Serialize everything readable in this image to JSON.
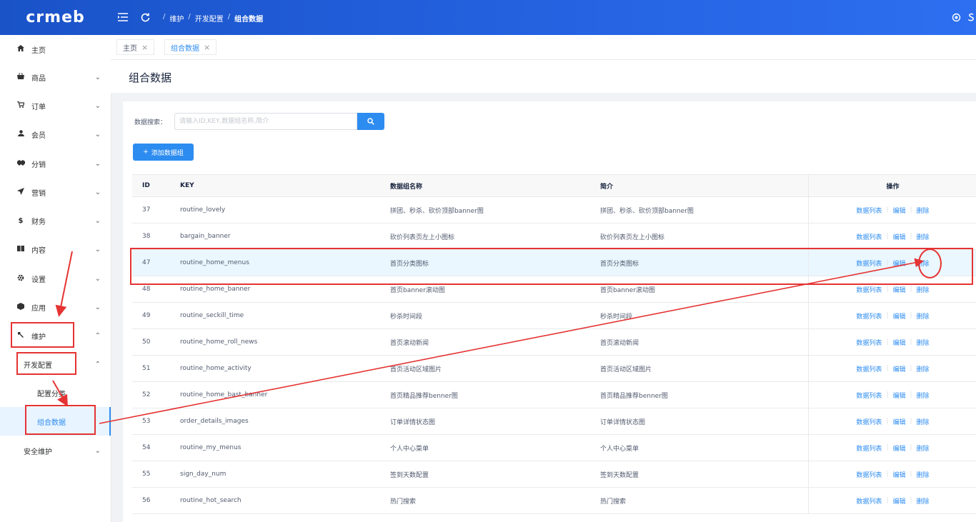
{
  "topbar": {
    "logo": "crmeb",
    "breadcrumb": [
      "维护",
      "开发配置",
      "组合数据"
    ],
    "colors": {
      "bar": "#1a53c8",
      "accent": "#2d8cf0"
    }
  },
  "sidebar": {
    "items": [
      {
        "label": "主页",
        "icon": "home-icon"
      },
      {
        "label": "商品",
        "icon": "shop-bag-icon"
      },
      {
        "label": "订单",
        "icon": "cart-icon"
      },
      {
        "label": "会员",
        "icon": "user-icon"
      },
      {
        "label": "分销",
        "icon": "handshake-icon"
      },
      {
        "label": "营销",
        "icon": "send-icon"
      },
      {
        "label": "财务",
        "icon": "dollar-icon"
      },
      {
        "label": "内容",
        "icon": "book-icon"
      },
      {
        "label": "设置",
        "icon": "gear-icon"
      },
      {
        "label": "应用",
        "icon": "cube-icon"
      },
      {
        "label": "维护",
        "icon": "hammer-icon"
      }
    ],
    "sub": {
      "dev_config": "开发配置",
      "config_category": "配置分类",
      "combined_data": "组合数据",
      "security": "安全维护"
    }
  },
  "tabs": [
    {
      "label": "主页"
    },
    {
      "label": "组合数据"
    }
  ],
  "page": {
    "title": "组合数据",
    "search_label": "数据搜索：",
    "search_placeholder": "请输入ID,KEY,数据组名称,简介",
    "add_button": "添加数据组"
  },
  "table": {
    "headers": {
      "id": "ID",
      "key": "KEY",
      "name": "数据组名称",
      "desc": "简介",
      "op": "操作"
    },
    "ops": {
      "list": "数据列表",
      "edit": "编辑",
      "delete": "删除"
    },
    "rows": [
      {
        "id": "37",
        "key": "routine_lovely",
        "name": "拼团、秒杀、砍价顶部banner图",
        "desc": "拼团、秒杀、砍价顶部banner图"
      },
      {
        "id": "38",
        "key": "bargain_banner",
        "name": "砍价列表页左上小图标",
        "desc": "砍价列表页左上小图标"
      },
      {
        "id": "47",
        "key": "routine_home_menus",
        "name": "首页分类图标",
        "desc": "首页分类图标"
      },
      {
        "id": "48",
        "key": "routine_home_banner",
        "name": "首页banner滚动图",
        "desc": "首页banner滚动图"
      },
      {
        "id": "49",
        "key": "routine_seckill_time",
        "name": "秒杀时间段",
        "desc": "秒杀时间段"
      },
      {
        "id": "50",
        "key": "routine_home_roll_news",
        "name": "首页滚动新闻",
        "desc": "首页滚动新闻"
      },
      {
        "id": "51",
        "key": "routine_home_activity",
        "name": "首页活动区域图片",
        "desc": "首页活动区域图片"
      },
      {
        "id": "52",
        "key": "routine_home_bast_banner",
        "name": "首页精品推荐benner图",
        "desc": "首页精品推荐benner图"
      },
      {
        "id": "53",
        "key": "order_details_images",
        "name": "订单详情状态图",
        "desc": "订单详情状态图"
      },
      {
        "id": "54",
        "key": "routine_my_menus",
        "name": "个人中心菜单",
        "desc": "个人中心菜单"
      },
      {
        "id": "55",
        "key": "sign_day_num",
        "name": "签到天数配置",
        "desc": "签到天数配置"
      },
      {
        "id": "56",
        "key": "routine_hot_search",
        "name": "热门搜索",
        "desc": "热门搜索"
      }
    ]
  }
}
